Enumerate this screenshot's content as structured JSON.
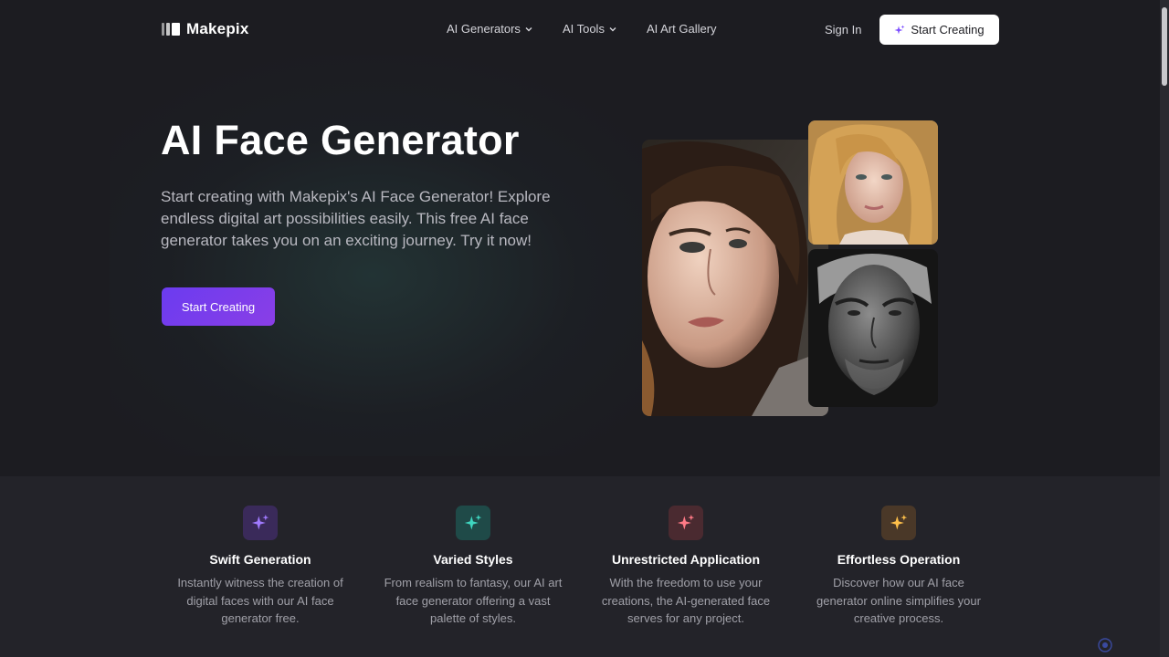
{
  "brand": {
    "name": "Makepix"
  },
  "nav": {
    "links": [
      {
        "label": "AI Generators",
        "dropdown": true
      },
      {
        "label": "AI Tools",
        "dropdown": true
      },
      {
        "label": "AI Art Gallery",
        "dropdown": false
      }
    ],
    "sign_in": "Sign In",
    "cta": "Start Creating"
  },
  "hero": {
    "title": "AI Face Generator",
    "description": "Start creating with Makepix's AI Face Generator! Explore endless digital art possibilities easily. This free AI face generator takes you on an exciting journey. Try it now!",
    "cta": "Start Creating"
  },
  "features": [
    {
      "title": "Swift Generation",
      "description": "Instantly witness the creation of digital faces with our AI face generator free.",
      "icon": "sparkle-icon",
      "color": "#8b5cf6"
    },
    {
      "title": "Varied Styles",
      "description": "From realism to fantasy, our AI art face generator offering a vast palette of styles.",
      "icon": "sparkle-icon",
      "color": "#2dd4bf"
    },
    {
      "title": "Unrestricted Application",
      "description": "With the freedom to use your creations, the AI-generated face serves for any project.",
      "icon": "sparkle-icon",
      "color": "#f87171"
    },
    {
      "title": "Effortless Operation",
      "description": "Discover how our AI face generator online simplifies your creative process.",
      "icon": "sparkle-icon",
      "color": "#fbbf24"
    }
  ],
  "colors": {
    "background": "#1c1c21",
    "accent": "#6b3cf0",
    "features_bg": "#232329"
  }
}
